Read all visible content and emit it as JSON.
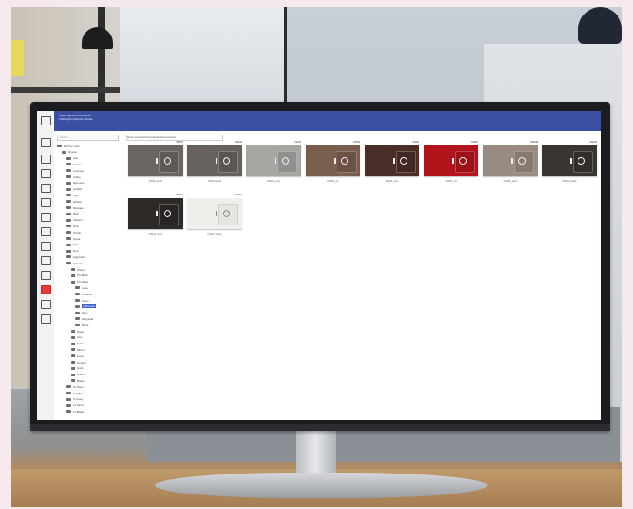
{
  "browser": {
    "url_line1": "https://fgcdn.com/sinks/fs/...",
    "url_line2": "Fp0KsgDmrA0ppzFyzEsGe"
  },
  "tree": {
    "search_placeholder": "Search...",
    "items": [
      {
        "label": "Kitchen sinks",
        "indent": 0
      },
      {
        "label": "Granite",
        "indent": 1
      },
      {
        "label": "Artic",
        "indent": 2
      },
      {
        "label": "Cardon",
        "indent": 2
      },
      {
        "label": "Concrete",
        "indent": 2
      },
      {
        "label": "Coffee",
        "indent": 2
      },
      {
        "label": "Espresso",
        "indent": 2
      },
      {
        "label": "Metallic",
        "indent": 2
      },
      {
        "label": "Onyx",
        "indent": 2
      },
      {
        "label": "Sahara",
        "indent": 2
      },
      {
        "label": "Rustique",
        "indent": 2
      },
      {
        "label": "Polar",
        "indent": 2
      },
      {
        "label": "Volcano",
        "indent": 2
      },
      {
        "label": "Rock",
        "indent": 2
      },
      {
        "label": "Tartufo",
        "indent": 2
      },
      {
        "label": "Alpina",
        "indent": 2
      },
      {
        "label": "Puro",
        "indent": 2
      },
      {
        "label": "Nero",
        "indent": 2
      },
      {
        "label": "Fragranite",
        "indent": 2
      },
      {
        "label": "Variante",
        "indent": 2
      },
      {
        "label": "Stone",
        "indent": 3
      },
      {
        "label": "FS Black",
        "indent": 3
      },
      {
        "label": "FS White",
        "indent": 3
      },
      {
        "label": "Lava",
        "indent": 4
      },
      {
        "label": "Ceramic",
        "indent": 4
      },
      {
        "label": "Stone",
        "indent": 4
      },
      {
        "label": "Anthracite",
        "indent": 4,
        "selected": true
      },
      {
        "label": "Grey",
        "indent": 4
      },
      {
        "label": "Magnolia",
        "indent": 4
      },
      {
        "label": "Black",
        "indent": 4
      },
      {
        "label": "Steel",
        "indent": 3
      },
      {
        "label": "Inox",
        "indent": 3
      },
      {
        "label": "Satin",
        "indent": 3
      },
      {
        "label": "Mirror",
        "indent": 3
      },
      {
        "label": "Linen",
        "indent": 3
      },
      {
        "label": "Copper",
        "indent": 3
      },
      {
        "label": "Gold",
        "indent": 3
      },
      {
        "label": "Bronze",
        "indent": 3
      },
      {
        "label": "Brass",
        "indent": 3
      },
      {
        "label": "FS Steel",
        "indent": 2
      },
      {
        "label": "FS White",
        "indent": 2
      },
      {
        "label": "FS Grey",
        "indent": 2
      },
      {
        "label": "FS Sand",
        "indent": 2
      },
      {
        "label": "FS Black",
        "indent": 2
      }
    ]
  },
  "content": {
    "breadcrumb": "fgcdn.com/sinks/fs/Granite/Variante/Anthracite",
    "thumbnails": [
      {
        "tag": "FS002",
        "color": "#6b6663",
        "caption": "FS002_anth"
      },
      {
        "tag": "FS003",
        "color": "#67625e",
        "caption": "FS003_anth"
      },
      {
        "tag": "FS004",
        "color": "#a6a6a3",
        "caption": "FS004_grey"
      },
      {
        "tag": "FS005",
        "color": "#7a5e4e",
        "caption": "FS005_tart"
      },
      {
        "tag": "FS006",
        "color": "#4b2e2a",
        "caption": "FS006_onyx"
      },
      {
        "tag": "FS007",
        "color": "#b3131a",
        "caption": "FS007_red"
      },
      {
        "tag": "FS008",
        "color": "#9a8b80",
        "caption": "FS008_sand"
      },
      {
        "tag": "FS009",
        "color": "#383533",
        "caption": "FS009_black"
      },
      {
        "tag": "FS010",
        "color": "#2e2a28",
        "caption": "FS010_nero"
      },
      {
        "tag": "FS011",
        "color": "#f0efeb",
        "caption": "FS011_white"
      }
    ]
  }
}
